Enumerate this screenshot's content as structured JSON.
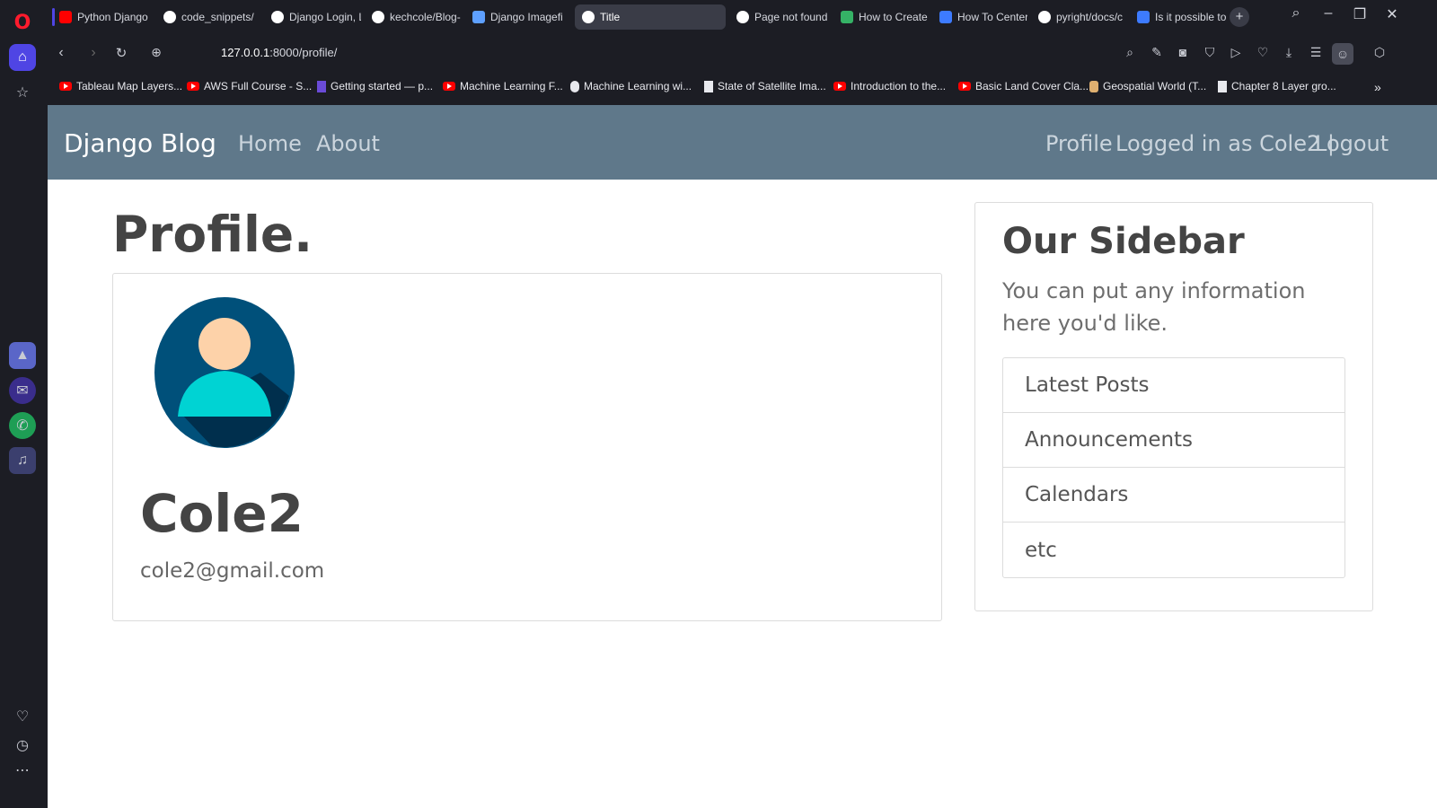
{
  "browser": {
    "tabs": [
      {
        "label": "Python Django",
        "icon": "youtube-icon",
        "color": "#ff0000"
      },
      {
        "label": "code_snippets/",
        "icon": "github-icon",
        "color": "#ffffff"
      },
      {
        "label": "Django Login, L",
        "icon": "globe-icon",
        "color": "#ffffff"
      },
      {
        "label": "kechcole/Blog-",
        "icon": "github-icon",
        "color": "#ffffff"
      },
      {
        "label": "Django Imagefi",
        "icon": "image-icon",
        "color": "#5ea0ff"
      },
      {
        "label": "Title",
        "icon": "globe-icon",
        "color": "#ffffff",
        "active": true
      },
      {
        "label": "Page not found",
        "icon": "globe-icon",
        "color": "#ffffff"
      },
      {
        "label": "How to Create",
        "icon": "link-icon",
        "color": "#35b266"
      },
      {
        "label": "How To Center",
        "icon": "bookmark-icon",
        "color": "#3d7bff"
      },
      {
        "label": "pyright/docs/c",
        "icon": "github-icon",
        "color": "#ffffff"
      },
      {
        "label": "Is it possible to",
        "icon": "book-icon",
        "color": "#3d7bff"
      }
    ],
    "url_host": "127.0.0.1",
    "url_path": ":8000/profile/",
    "bookmarks": [
      {
        "label": "Tableau Map Layers...",
        "icon": "youtube-icon"
      },
      {
        "label": "AWS Full Course - S...",
        "icon": "youtube-icon"
      },
      {
        "label": "Getting started — p...",
        "icon": "page-icon"
      },
      {
        "label": "Machine Learning F...",
        "icon": "youtube-icon"
      },
      {
        "label": "Machine Learning wi...",
        "icon": "page-icon"
      },
      {
        "label": "State of Satellite Ima...",
        "icon": "page-icon"
      },
      {
        "label": "Introduction to the...",
        "icon": "youtube-icon"
      },
      {
        "label": "Basic Land Cover Cla...",
        "icon": "youtube-icon"
      },
      {
        "label": "Geospatial World (T...",
        "icon": "page-icon"
      },
      {
        "label": "Chapter 8 Layer gro...",
        "icon": "page-icon"
      }
    ]
  },
  "site": {
    "brand": "Django Blog",
    "nav_left": [
      "Home",
      "About"
    ],
    "nav_right": {
      "profile": "Profile",
      "logged_in": "Logged in as Cole2 |",
      "logout": "Logout"
    }
  },
  "profile": {
    "heading": "Profile.",
    "username": "Cole2",
    "email": "cole2@gmail.com"
  },
  "sidebar": {
    "title": "Our Sidebar",
    "text": "You can put any information here you'd like.",
    "items": [
      "Latest Posts",
      "Announcements",
      "Calendars",
      "etc"
    ]
  },
  "colors": {
    "navbar": "#5f788a",
    "accent": "#4f45e4"
  }
}
